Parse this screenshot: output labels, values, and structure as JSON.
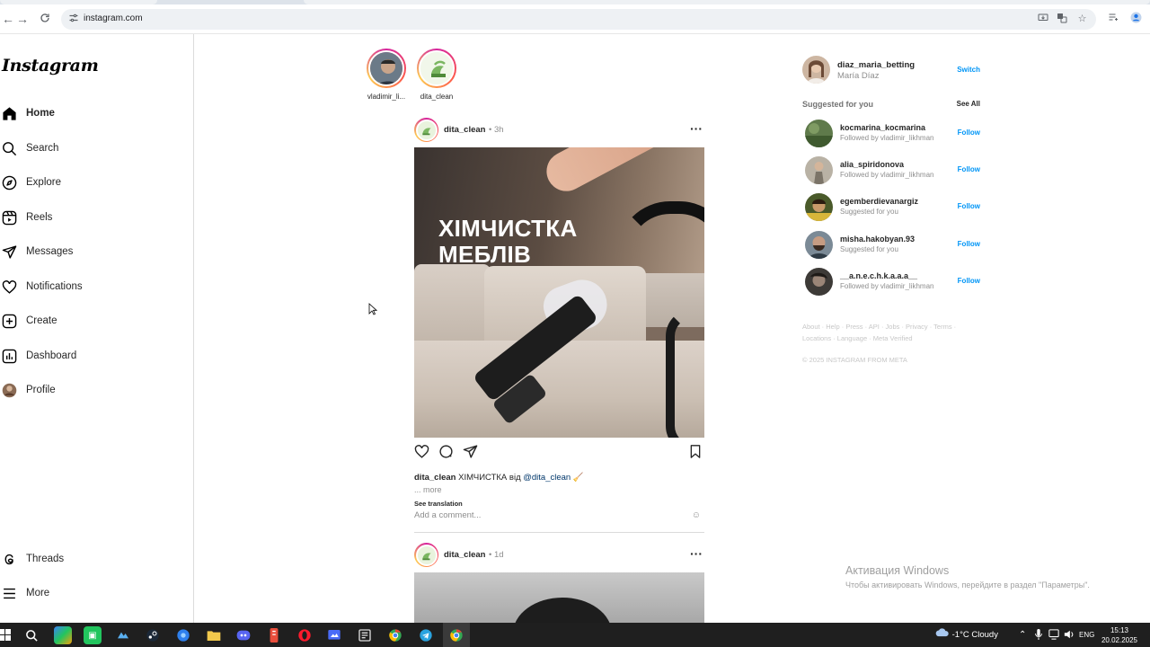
{
  "browser": {
    "url": "instagram.com",
    "back_icon": "back-arrow",
    "forward_icon": "forward-arrow",
    "reload_icon": "reload"
  },
  "sidebar": {
    "logo": "Instagram",
    "items": [
      {
        "label": "Home",
        "icon": "home-icon"
      },
      {
        "label": "Search",
        "icon": "search-icon"
      },
      {
        "label": "Explore",
        "icon": "compass-icon"
      },
      {
        "label": "Reels",
        "icon": "reels-icon"
      },
      {
        "label": "Messages",
        "icon": "paper-plane-icon"
      },
      {
        "label": "Notifications",
        "icon": "heart-icon"
      },
      {
        "label": "Create",
        "icon": "plus-square-icon"
      },
      {
        "label": "Dashboard",
        "icon": "chart-icon"
      },
      {
        "label": "Profile",
        "icon": "avatar"
      }
    ],
    "bottom": [
      {
        "label": "Threads",
        "icon": "threads-icon"
      },
      {
        "label": "More",
        "icon": "menu-icon"
      }
    ]
  },
  "stories": [
    {
      "name": "vladimir_li..."
    },
    {
      "name": "dita_clean"
    }
  ],
  "posts": [
    {
      "user": "dita_clean",
      "time": "• 3h",
      "image_text": [
        "ХІМЧИСТКА",
        "МЕБЛІВ"
      ],
      "caption_user": "dita_clean",
      "caption_text": " ХІМЧИСТКА від ",
      "caption_mention": "@dita_clean",
      "caption_emoji": " 🧹",
      "more": "... more",
      "see_translation": "See translation",
      "comment_placeholder": "Add a comment..."
    },
    {
      "user": "dita_clean",
      "time": "• 1d"
    }
  ],
  "account": {
    "username": "diaz_maria_betting",
    "full_name": "María Díaz",
    "switch": "Switch"
  },
  "suggestions": {
    "heading": "Suggested for you",
    "see_all": "See All",
    "items": [
      {
        "username": "kocmarina_kocmarina",
        "sub": "Followed by vladimir_likhman",
        "action": "Follow"
      },
      {
        "username": "alia_spiridonova",
        "sub": "Followed by vladimir_likhman",
        "action": "Follow"
      },
      {
        "username": "egemberdievanargiz",
        "sub": "Suggested for you",
        "action": "Follow"
      },
      {
        "username": "misha.hakobyan.93",
        "sub": "Suggested for you",
        "action": "Follow"
      },
      {
        "username": "__a.n.e.c.h.k.a.a.a__",
        "sub": "Followed by vladimir_likhman",
        "action": "Follow"
      }
    ]
  },
  "footer": {
    "links": "About · Help · Press · API · Jobs · Privacy · Terms ·",
    "links2": "Locations · Language · Meta Verified",
    "copyright": "© 2025 INSTAGRAM FROM META"
  },
  "windows": {
    "activate_title": "Активация Windows",
    "activate_sub": "Чтобы активировать Windows, перейдите в раздел \"Параметры\".",
    "weather": "-1°C  Cloudy",
    "lang": "ENG",
    "time": "15:13",
    "date": "20.02.2025"
  },
  "colors": {
    "accent": "#0095f6",
    "border": "#dbdbdb",
    "taskbar": "#1f1f1f"
  }
}
